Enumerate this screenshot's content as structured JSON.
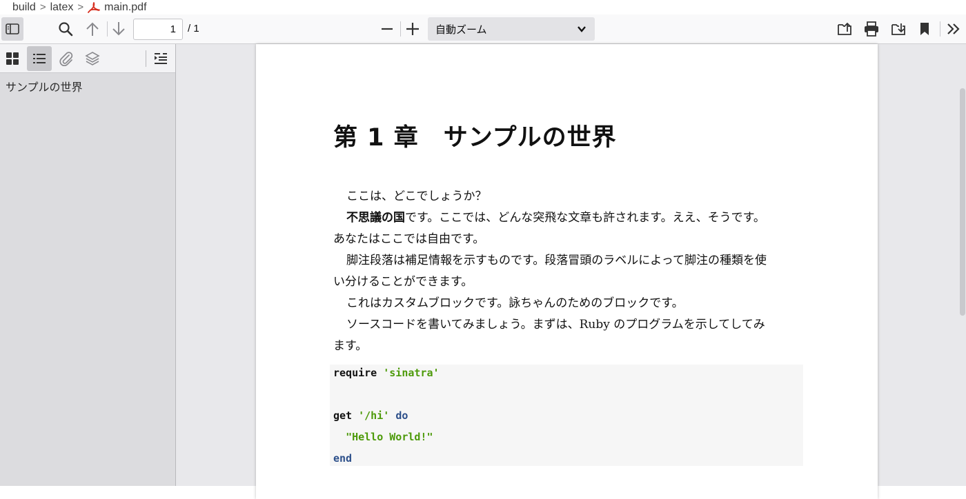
{
  "breadcrumb": {
    "items": [
      "build",
      "latex",
      "main.pdf"
    ],
    "separator": ">"
  },
  "toolbar": {
    "page_value": "1",
    "page_count": "/ 1",
    "zoom_label": "自動ズーム"
  },
  "sidebar": {
    "outline": [
      {
        "label": "サンプルの世界"
      }
    ]
  },
  "document": {
    "chapter_title": "第 1 章　サンプルの世界",
    "paragraphs": [
      {
        "lines": [
          "ここは、どこでしょうか？"
        ]
      },
      {
        "bold": "不思議の国",
        "lines": [
          "です。ここでは、どんな突飛な文章も許されます。ええ、そうです。",
          "あなたはここでは自由です。"
        ]
      },
      {
        "lines": [
          "脚注段落は補足情報を示すものです。段落冒頭のラベルによって脚注の種類を使",
          "い分けることができます。"
        ]
      },
      {
        "lines": [
          "これはカスタムブロックです。詠ちゃんのためのブロックです。"
        ]
      },
      {
        "lines": [
          "ソースコードを書いてみましょう。まずは、Ruby のプログラムを示してしてみ",
          "ます。"
        ]
      }
    ],
    "code": {
      "line1_kw": "require",
      "line1_str": "'sinatra'",
      "line3_kw": "get",
      "line3_str": "'/hi'",
      "line3_kw2": "do",
      "line4_str": "\"Hello World!\"",
      "line5_kw2": "end"
    }
  },
  "colors": {
    "pdf_icon": "#d62e1f",
    "code_string": "#4d9a0a",
    "code_keyword_blue": "#2c4f8a"
  }
}
